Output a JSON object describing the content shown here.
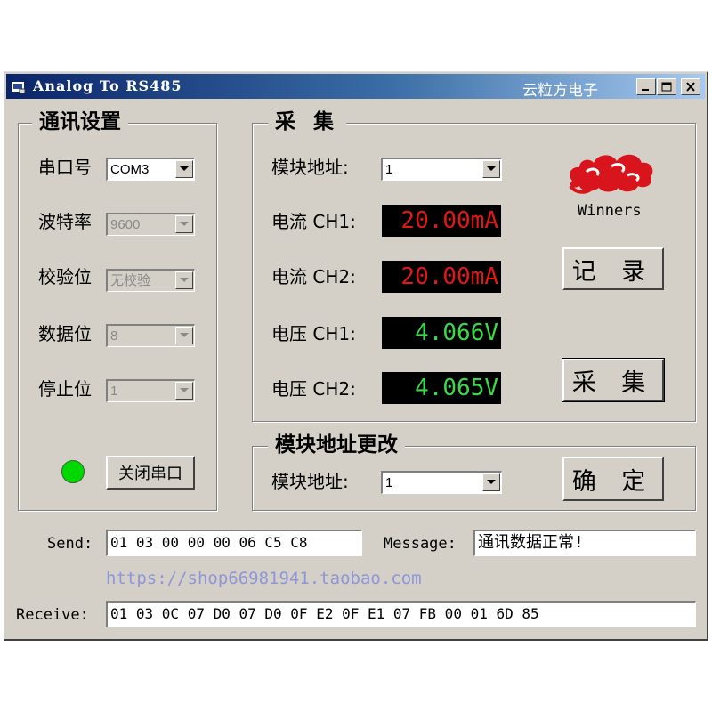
{
  "window": {
    "title": "Analog To RS485",
    "brand": "云粒方电子",
    "titlebar_color": "#0a246a"
  },
  "comm_settings": {
    "title": "通讯设置",
    "port_label": "串口号",
    "port_value": "COM3",
    "baud_label": "波特率",
    "baud_value": "9600",
    "parity_label": "校验位",
    "parity_value": "无校验",
    "databits_label": "数据位",
    "databits_value": "8",
    "stopbits_label": "停止位",
    "stopbits_value": "1",
    "status_led_color": "#00d800",
    "close_button": "关闭串口"
  },
  "acquire": {
    "title": "采 集",
    "address_label": "模块地址:",
    "address_value": "1",
    "current_ch1_label": "电流 CH1:",
    "current_ch1_value": "20.00mA",
    "current_ch2_label": "电流 CH2:",
    "current_ch2_value": "20.00mA",
    "voltage_ch1_label": "电压 CH1:",
    "voltage_ch1_value": "4.066V",
    "voltage_ch2_label": "电压 CH2:",
    "voltage_ch2_value": "4.065V",
    "current_color": "#e01818",
    "voltage_color": "#3cd84a",
    "logo_text": "Winners",
    "record_button": "记 录",
    "acquire_button": "采 集"
  },
  "address_change": {
    "title": "模块地址更改",
    "address_label": "模块地址:",
    "address_value": "1",
    "confirm_button": "确 定"
  },
  "bottom": {
    "send_label": "Send:",
    "send_value": "01 03 00 00 00 06 C5 C8",
    "message_label": "Message:",
    "message_value": "通讯数据正常!",
    "link_text": "https://shop66981941.taobao.com",
    "receive_label": "Receive:",
    "receive_value": "01 03 0C 07 D0 07 D0 0F E2 0F E1 07 FB 00 01 6D 85"
  }
}
